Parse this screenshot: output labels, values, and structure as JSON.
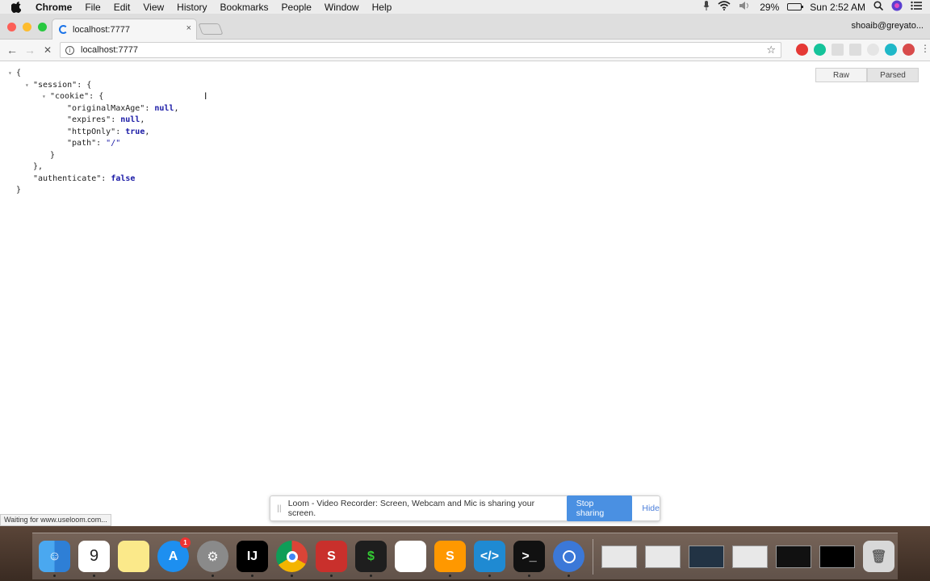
{
  "menubar": {
    "items": [
      "Chrome",
      "File",
      "Edit",
      "View",
      "History",
      "Bookmarks",
      "People",
      "Window",
      "Help"
    ],
    "battery": "29%",
    "clock": "Sun 2:52 AM",
    "battery_level": 0.29
  },
  "browser": {
    "tab_title": "localhost:7777",
    "tab_close": "×",
    "profile": "shoaib@greyato...",
    "address": "localhost:7777",
    "address_info": "i",
    "star": "☆"
  },
  "json_view": {
    "lines": [
      {
        "indent": 0,
        "twisty": "▾",
        "parts": [
          [
            "p",
            "{"
          ]
        ]
      },
      {
        "indent": 1,
        "twisty": "▾",
        "parts": [
          [
            "k",
            "\"session\""
          ],
          [
            "p",
            ": {"
          ]
        ]
      },
      {
        "indent": 2,
        "twisty": "▾",
        "parts": [
          [
            "k",
            "\"cookie\""
          ],
          [
            "p",
            ": {"
          ]
        ]
      },
      {
        "indent": 3,
        "twisty": "",
        "parts": [
          [
            "k",
            "\"originalMaxAge\""
          ],
          [
            "p",
            ": "
          ],
          [
            "v",
            "null"
          ],
          [
            "p",
            ","
          ]
        ]
      },
      {
        "indent": 3,
        "twisty": "",
        "parts": [
          [
            "k",
            "\"expires\""
          ],
          [
            "p",
            ": "
          ],
          [
            "v",
            "null"
          ],
          [
            "p",
            ","
          ]
        ]
      },
      {
        "indent": 3,
        "twisty": "",
        "parts": [
          [
            "k",
            "\"httpOnly\""
          ],
          [
            "p",
            ": "
          ],
          [
            "v",
            "true"
          ],
          [
            "p",
            ","
          ]
        ]
      },
      {
        "indent": 3,
        "twisty": "",
        "parts": [
          [
            "k",
            "\"path\""
          ],
          [
            "p",
            ": "
          ],
          [
            "s",
            "\"/\""
          ]
        ]
      },
      {
        "indent": 2,
        "twisty": "",
        "parts": [
          [
            "p",
            "}"
          ]
        ]
      },
      {
        "indent": 1,
        "twisty": "",
        "parts": [
          [
            "p",
            "},"
          ]
        ]
      },
      {
        "indent": 1,
        "twisty": "",
        "parts": [
          [
            "k",
            "\"authenticate\""
          ],
          [
            "p",
            ": "
          ],
          [
            "v",
            "false"
          ]
        ]
      },
      {
        "indent": 0,
        "twisty": "",
        "parts": [
          [
            "p",
            "}"
          ]
        ]
      }
    ],
    "raw_label": "Raw",
    "parsed_label": "Parsed"
  },
  "status_text": "Waiting for www.useloom.com...",
  "loom_bar": {
    "grip": "||",
    "message": "Loom - Video Recorder: Screen, Webcam and Mic is sharing your screen.",
    "stop_label": "Stop sharing",
    "hide_label": "Hide"
  },
  "dock": {
    "calendar_day": "9",
    "app_store_badge": "1",
    "apps": [
      "finder",
      "calendar",
      "notes",
      "app-store",
      "system-preferences",
      "intellij",
      "chrome",
      "sublime-s",
      "terminal",
      "reminders",
      "sublime-text",
      "vscode",
      "terminal-2",
      "chrome-2"
    ]
  }
}
